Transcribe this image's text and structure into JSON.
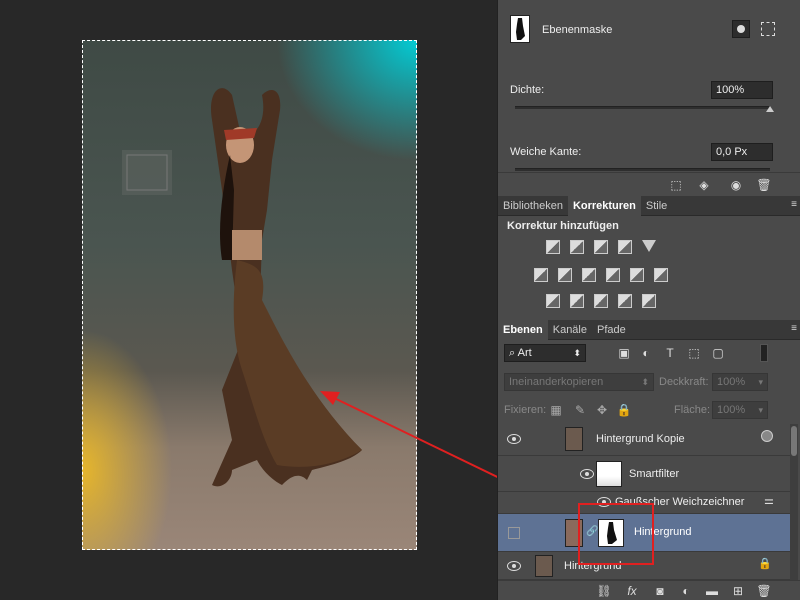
{
  "mask_panel": {
    "title": "Ebenenmaske",
    "density_label": "Dichte:",
    "density_value": "100%",
    "feather_label": "Weiche Kante:",
    "feather_value": "0,0 Px"
  },
  "adjust_tabs": [
    {
      "label": "Bibliotheken"
    },
    {
      "label": "Korrekturen"
    },
    {
      "label": "Stile"
    }
  ],
  "adjust_title": "Korrektur hinzufügen",
  "layers_tabs": [
    {
      "label": "Ebenen"
    },
    {
      "label": "Kanäle"
    },
    {
      "label": "Pfade"
    }
  ],
  "layers": {
    "filter_kind": "Art",
    "blend_mode": "Ineinanderkopieren",
    "opacity_label": "Deckkraft:",
    "opacity_value": "100%",
    "lock_label": "Fixieren:",
    "fill_label": "Fläche:",
    "fill_value": "100%",
    "items": [
      {
        "name": "Hintergrund Kopie"
      },
      {
        "name": "Smartfilter"
      },
      {
        "name": "Gaußscher Weichzeichner"
      },
      {
        "name": "Hintergrund"
      },
      {
        "name": "Hintergrund"
      }
    ]
  },
  "colors": {
    "panel": "#4a4a4a",
    "selected_layer": "#5e7294",
    "annotation": "#e02020"
  }
}
